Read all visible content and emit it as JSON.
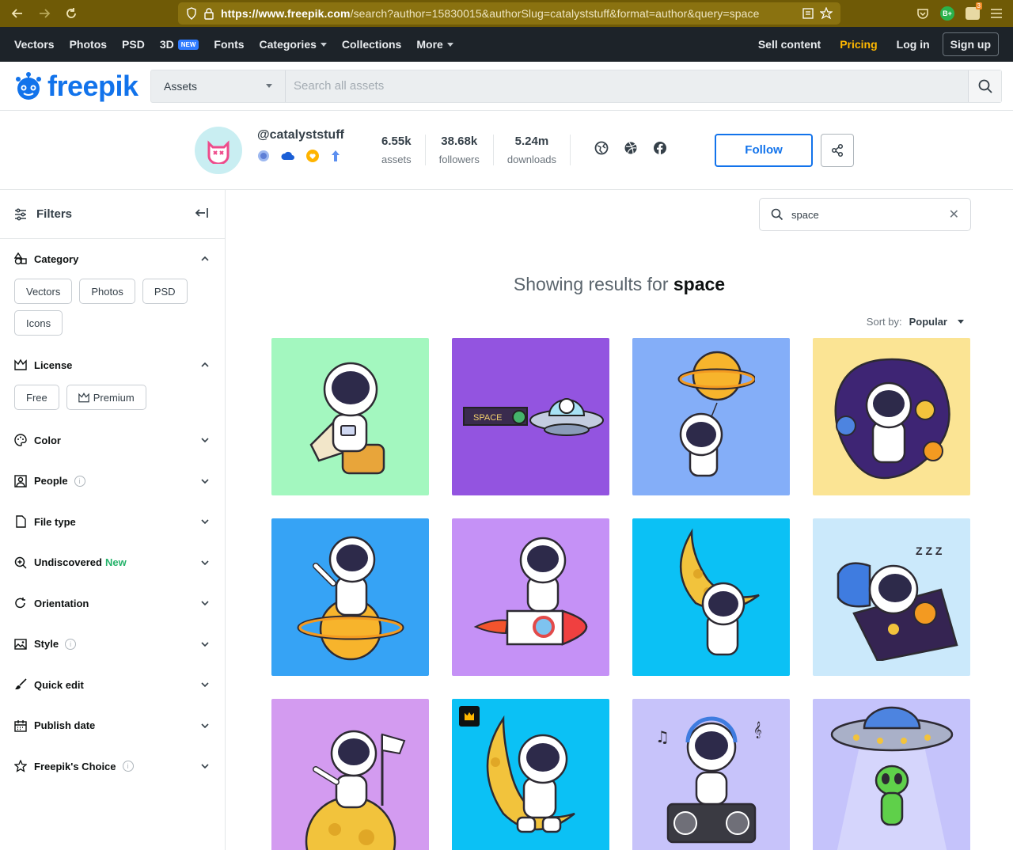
{
  "browser": {
    "url_host": "https://www.freepik.com",
    "url_rest": "/search?author=15830015&authorSlug=catalyststuff&format=author&query=space",
    "ext_badge": "B+",
    "ext_count": "3"
  },
  "topnav": {
    "items": [
      "Vectors",
      "Photos",
      "PSD",
      "3D",
      "Fonts",
      "Categories",
      "Collections",
      "More"
    ],
    "new_tag": "NEW",
    "sell": "Sell content",
    "pricing": "Pricing",
    "login": "Log in",
    "signup": "Sign up"
  },
  "header": {
    "logo_text": "freepik",
    "assets_label": "Assets",
    "search_placeholder": "Search all assets"
  },
  "profile": {
    "handle": "@catalyststuff",
    "stats": [
      {
        "value": "6.55k",
        "label": "assets"
      },
      {
        "value": "38.68k",
        "label": "followers"
      },
      {
        "value": "5.24m",
        "label": "downloads"
      }
    ],
    "follow_label": "Follow"
  },
  "filters": {
    "title": "Filters",
    "category": {
      "label": "Category",
      "chips": [
        "Vectors",
        "Photos",
        "PSD",
        "Icons"
      ]
    },
    "license": {
      "label": "License",
      "chips": [
        "Free",
        "Premium"
      ]
    },
    "sections": [
      {
        "label": "Color",
        "icon": "palette-icon"
      },
      {
        "label": "People",
        "icon": "people-icon",
        "info": true
      },
      {
        "label": "File type",
        "icon": "file-icon"
      },
      {
        "label": "Undiscovered",
        "icon": "search-plus-icon",
        "new": "New"
      },
      {
        "label": "Orientation",
        "icon": "rotate-icon"
      },
      {
        "label": "Style",
        "icon": "image-icon",
        "info": true
      },
      {
        "label": "Quick edit",
        "icon": "brush-icon"
      },
      {
        "label": "Publish date",
        "icon": "calendar-icon"
      },
      {
        "label": "Freepik's Choice",
        "icon": "star-icon",
        "info": true
      }
    ]
  },
  "results": {
    "search_value": "space",
    "heading_prefix": "Showing results for",
    "heading_query": "space",
    "sort_label": "Sort by:",
    "sort_value": "Popular",
    "tiles": [
      {
        "bg": "#a3f7bf",
        "name": "astronaut-with-suitcase-thumb"
      },
      {
        "bg": "#9354e0",
        "name": "astronaut-ufo-space-banner-thumb",
        "text": "SPACE"
      },
      {
        "bg": "#84aef8",
        "name": "astronaut-planet-balloon-thumb"
      },
      {
        "bg": "#fbe494",
        "name": "astronaut-floating-space-thumb"
      },
      {
        "bg": "#36a3f5",
        "name": "astronaut-sitting-planet-thumb"
      },
      {
        "bg": "#c591f6",
        "name": "astronaut-riding-rocket-thumb"
      },
      {
        "bg": "#0bc1f5",
        "name": "astronaut-hanging-moon-thumb"
      },
      {
        "bg": "#cbe9fb",
        "name": "astronaut-sleeping-thumb",
        "text": "Z Z Z"
      },
      {
        "bg": "#d39bf0",
        "name": "astronaut-flag-moon-thumb"
      },
      {
        "bg": "#0bc1f5",
        "name": "astronaut-moon-premium-thumb",
        "premium": true
      },
      {
        "bg": "#c7c3fa",
        "name": "astronaut-music-boombox-thumb"
      },
      {
        "bg": "#c5c3fb",
        "name": "alien-ufo-thumb"
      }
    ]
  }
}
